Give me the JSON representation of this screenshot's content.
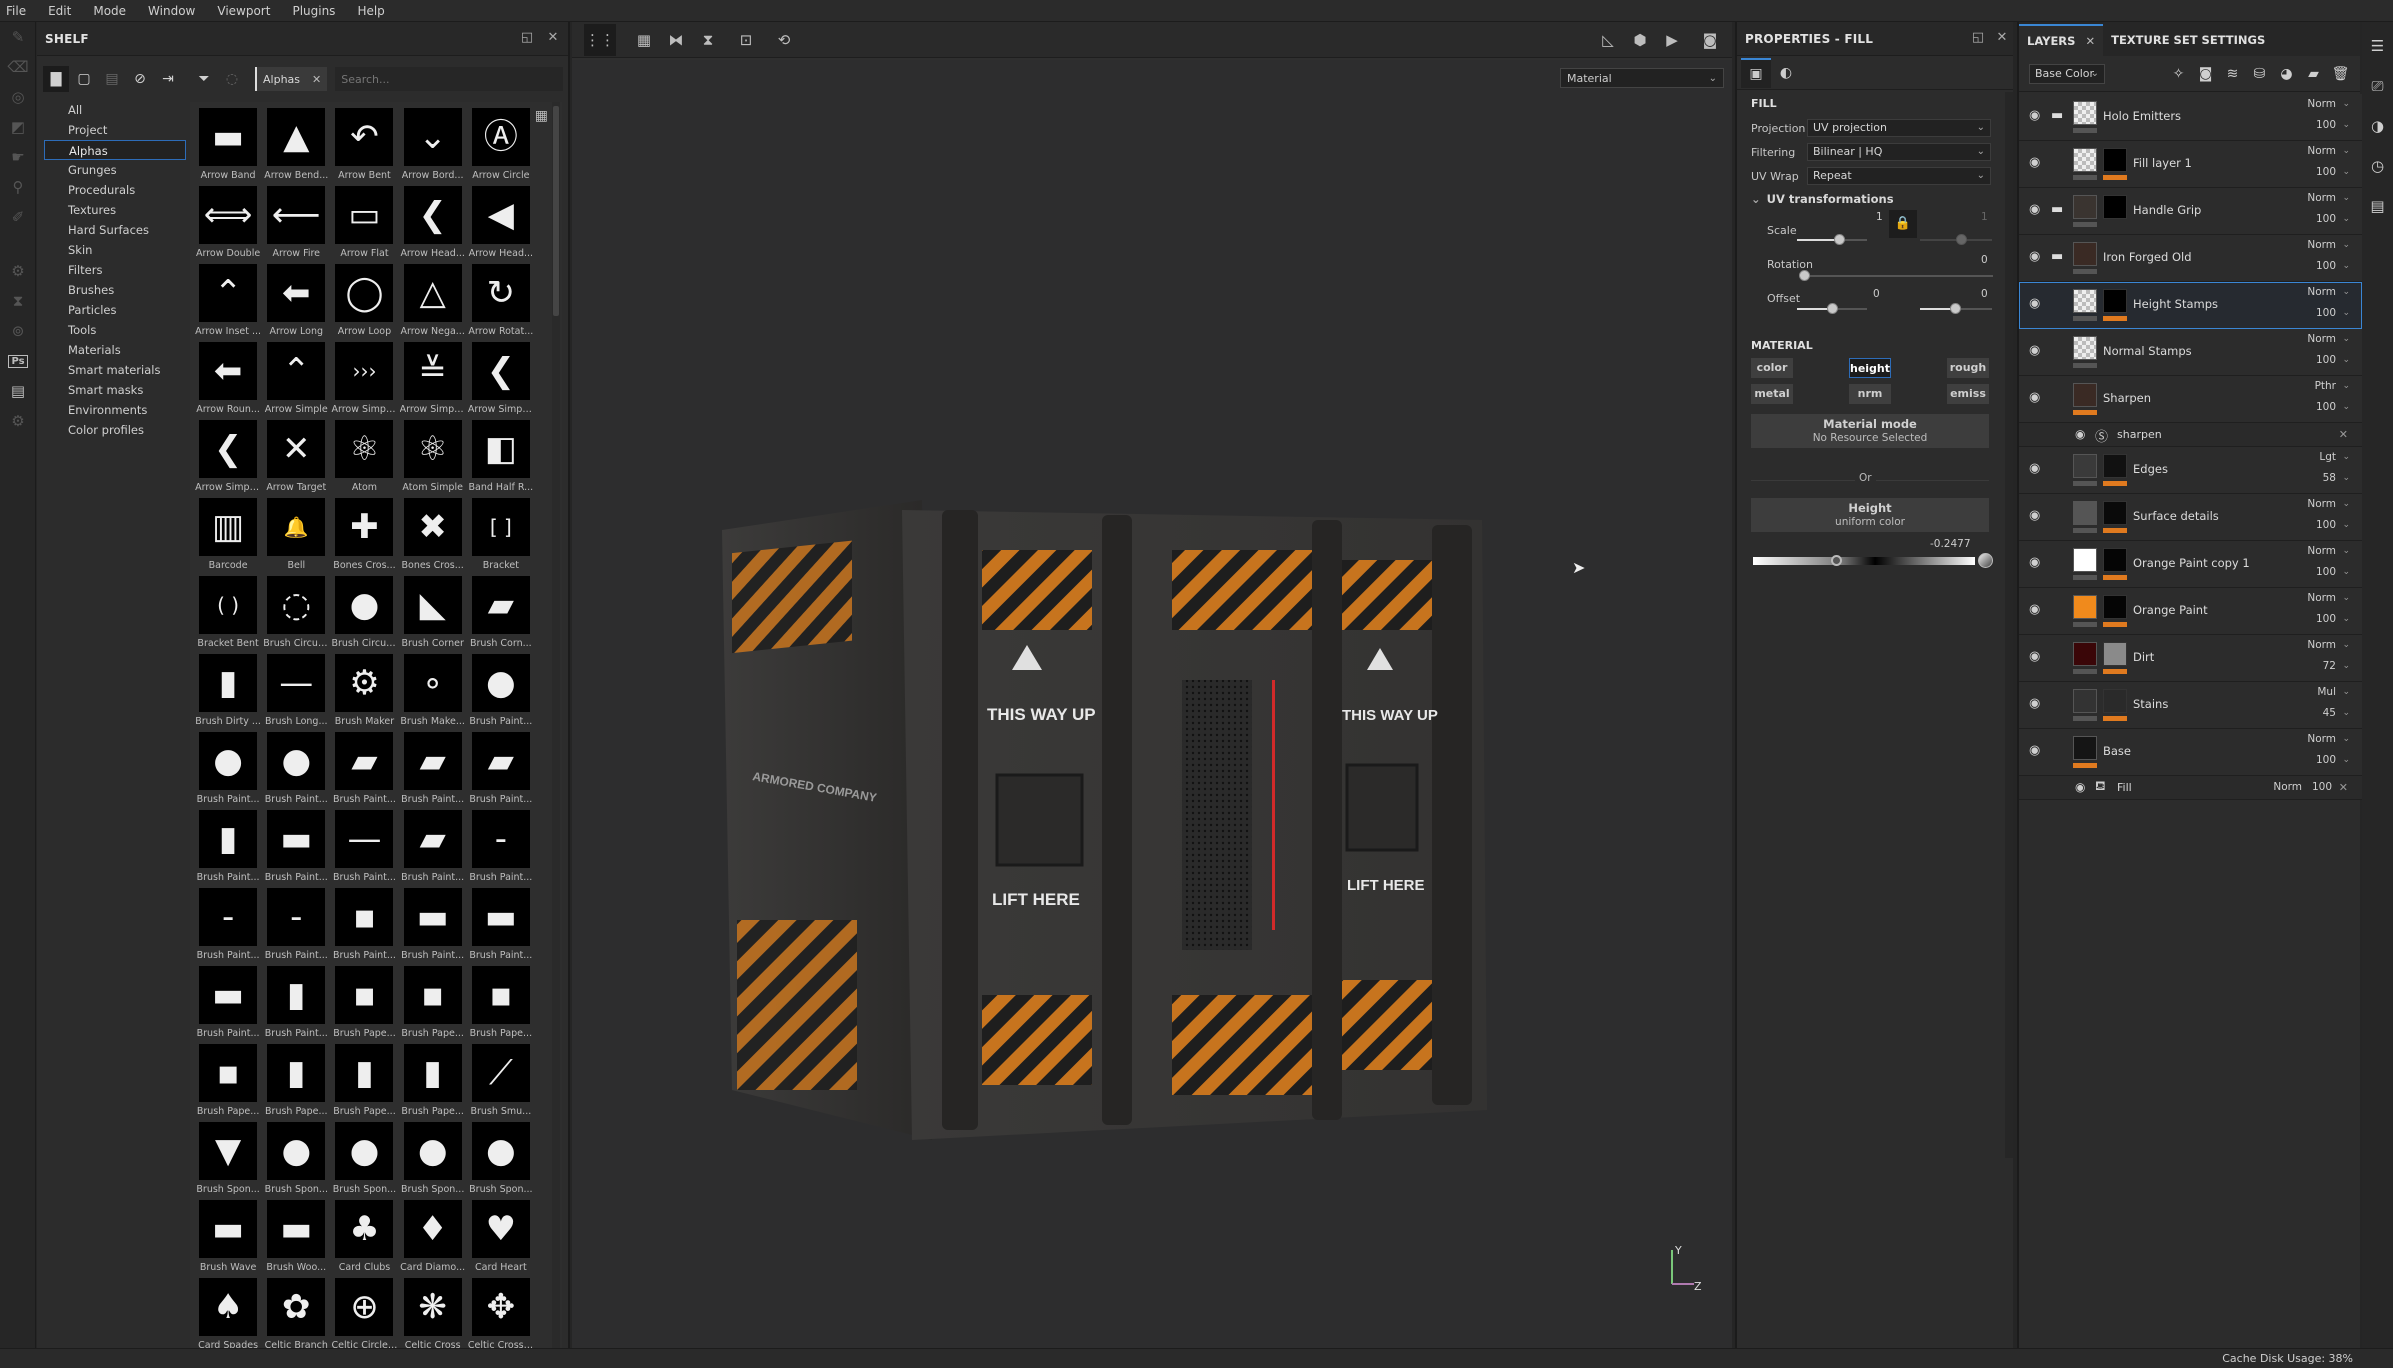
{
  "menu": [
    "File",
    "Edit",
    "Mode",
    "Window",
    "Viewport",
    "Plugins",
    "Help"
  ],
  "toolstrip": [
    "paint-brush-icon",
    "eraser-icon",
    "projection-icon",
    "geometry-mask-icon",
    "smudge-icon",
    "clone-stamp-icon",
    "color-picker-icon",
    "",
    "substance-icon",
    "bake-icon",
    "substance-share-icon",
    "photoshop-export-icon",
    "document-icon",
    "substance-source-icon"
  ],
  "shelf": {
    "title": "SHELF",
    "filter_chip": "Alphas",
    "search_placeholder": "Search...",
    "categories": [
      "All",
      "Project",
      "Alphas",
      "Grunges",
      "Procedurals",
      "Textures",
      "Hard Surfaces",
      "Skin",
      "Filters",
      "Brushes",
      "Particles",
      "Tools",
      "Materials",
      "Smart materials",
      "Smart masks",
      "Environments",
      "Color profiles"
    ],
    "selected_category": "Alphas",
    "items": [
      {
        "name": "Arrow Band",
        "glyph": "▬"
      },
      {
        "name": "Arrow Bend...",
        "glyph": "▲"
      },
      {
        "name": "Arrow Bent",
        "glyph": "↶"
      },
      {
        "name": "Arrow Bord...",
        "glyph": "⌄"
      },
      {
        "name": "Arrow Circle",
        "glyph": "Ⓐ"
      },
      {
        "name": "Arrow Double",
        "glyph": "⟺"
      },
      {
        "name": "Arrow Fire",
        "glyph": "⟵"
      },
      {
        "name": "Arrow Flat",
        "glyph": "▭"
      },
      {
        "name": "Arrow Head...",
        "glyph": "❮"
      },
      {
        "name": "Arrow Head...",
        "glyph": "◀"
      },
      {
        "name": "Arrow Inset ...",
        "glyph": "⌃"
      },
      {
        "name": "Arrow Long",
        "glyph": "⬅"
      },
      {
        "name": "Arrow Loop",
        "glyph": "◯"
      },
      {
        "name": "Arrow Nega...",
        "glyph": "△"
      },
      {
        "name": "Arrow Rotat...",
        "glyph": "↻"
      },
      {
        "name": "Arrow Roun...",
        "glyph": "⬅"
      },
      {
        "name": "Arrow Simple",
        "glyph": "⌃"
      },
      {
        "name": "Arrow Simpl...",
        "glyph": "›››"
      },
      {
        "name": "Arrow Simpl...",
        "glyph": "≚"
      },
      {
        "name": "Arrow Simpl...",
        "glyph": "❮"
      },
      {
        "name": "Arrow Simpl...",
        "glyph": "❮"
      },
      {
        "name": "Arrow Target",
        "glyph": "✕"
      },
      {
        "name": "Atom",
        "glyph": "⚛"
      },
      {
        "name": "Atom Simple",
        "glyph": "⚛"
      },
      {
        "name": "Band Half R...",
        "glyph": "◧"
      },
      {
        "name": "Barcode",
        "glyph": "▥"
      },
      {
        "name": "Bell",
        "glyph": "🔔"
      },
      {
        "name": "Bones Cros...",
        "glyph": "✚"
      },
      {
        "name": "Bones Cros...",
        "glyph": "✖"
      },
      {
        "name": "Bracket",
        "glyph": "[ ]"
      },
      {
        "name": "Bracket Bent",
        "glyph": "( )"
      },
      {
        "name": "Brush Circul...",
        "glyph": "◌"
      },
      {
        "name": "Brush Circul...",
        "glyph": "●"
      },
      {
        "name": "Brush Corner",
        "glyph": "◣"
      },
      {
        "name": "Brush Corn...",
        "glyph": "▰"
      },
      {
        "name": "Brush Dirty ...",
        "glyph": "▮"
      },
      {
        "name": "Brush Long...",
        "glyph": "—"
      },
      {
        "name": "Brush Maker",
        "glyph": "⚙"
      },
      {
        "name": "Brush Make...",
        "glyph": "∘"
      },
      {
        "name": "Brush Paint...",
        "glyph": "●"
      },
      {
        "name": "Brush Paint...",
        "glyph": "●"
      },
      {
        "name": "Brush Paint...",
        "glyph": "●"
      },
      {
        "name": "Brush Paint...",
        "glyph": "▰"
      },
      {
        "name": "Brush Paint...",
        "glyph": "▰"
      },
      {
        "name": "Brush Paint...",
        "glyph": "▰"
      },
      {
        "name": "Brush Paint...",
        "glyph": "▮"
      },
      {
        "name": "Brush Paint...",
        "glyph": "▬"
      },
      {
        "name": "Brush Paint...",
        "glyph": "—"
      },
      {
        "name": "Brush Paint...",
        "glyph": "▰"
      },
      {
        "name": "Brush Paint...",
        "glyph": "-"
      },
      {
        "name": "Brush Paint...",
        "glyph": "-"
      },
      {
        "name": "Brush Paint...",
        "glyph": "-"
      },
      {
        "name": "Brush Paint...",
        "glyph": "▪"
      },
      {
        "name": "Brush Paint...",
        "glyph": "▬"
      },
      {
        "name": "Brush Paint...",
        "glyph": "▬"
      },
      {
        "name": "Brush Paint...",
        "glyph": "▬"
      },
      {
        "name": "Brush Paint...",
        "glyph": "▮"
      },
      {
        "name": "Brush Pape...",
        "glyph": "▪"
      },
      {
        "name": "Brush Pape...",
        "glyph": "▪"
      },
      {
        "name": "Brush Pape...",
        "glyph": "▪"
      },
      {
        "name": "Brush Pape...",
        "glyph": "▪"
      },
      {
        "name": "Brush Pape...",
        "glyph": "▮"
      },
      {
        "name": "Brush Pape...",
        "glyph": "▮"
      },
      {
        "name": "Brush Pape...",
        "glyph": "▮"
      },
      {
        "name": "Brush Smu...",
        "glyph": "⟋"
      },
      {
        "name": "Brush Spon...",
        "glyph": "▼"
      },
      {
        "name": "Brush Spon...",
        "glyph": "●"
      },
      {
        "name": "Brush Spon...",
        "glyph": "●"
      },
      {
        "name": "Brush Spon...",
        "glyph": "●"
      },
      {
        "name": "Brush Spon...",
        "glyph": "●"
      },
      {
        "name": "Brush Wave",
        "glyph": "▬"
      },
      {
        "name": "Brush Woo...",
        "glyph": "▬"
      },
      {
        "name": "Card Clubs",
        "glyph": "♣"
      },
      {
        "name": "Card Diamo...",
        "glyph": "♦"
      },
      {
        "name": "Card Heart",
        "glyph": "♥"
      },
      {
        "name": "Card Spades",
        "glyph": "♠"
      },
      {
        "name": "Celtic Branch",
        "glyph": "✿"
      },
      {
        "name": "Celtic Circle ...",
        "glyph": "⊕"
      },
      {
        "name": "Celtic Cross",
        "glyph": "❋"
      },
      {
        "name": "Celtic Cross ...",
        "glyph": "✥"
      }
    ]
  },
  "viewport": {
    "channel_select": "Material",
    "model_labels": [
      "THIS WAY UP",
      "LIFT HERE",
      "ARMORED COMPANY"
    ],
    "axis_labels": {
      "y": "Y",
      "z": "Z"
    }
  },
  "properties": {
    "title": "PROPERTIES - FILL",
    "fill_section": "FILL",
    "projection_label": "Projection",
    "projection_value": "UV projection",
    "filtering_label": "Filtering",
    "filtering_value": "Bilinear | HQ",
    "uvwrap_label": "UV Wrap",
    "uvwrap_value": "Repeat",
    "uv_transformations": "UV transformations",
    "scale_label": "Scale",
    "scale_u": "1",
    "scale_v": "1",
    "rotation_label": "Rotation",
    "rotation_value": "0",
    "offset_label": "Offset",
    "offset_u": "0",
    "offset_v": "0",
    "material_section": "MATERIAL",
    "channels": [
      {
        "label": "color",
        "active": false
      },
      {
        "label": "height",
        "active": true
      },
      {
        "label": "rough",
        "active": false
      },
      {
        "label": "metal",
        "active": false
      },
      {
        "label": "nrm",
        "active": false
      },
      {
        "label": "emiss",
        "active": false
      }
    ],
    "material_mode_title": "Material mode",
    "material_mode_sub": "No Resource Selected",
    "or_label": "Or",
    "height_title": "Height",
    "height_sub": "uniform color",
    "height_value": "-0.2477",
    "height_normalized": 0.38
  },
  "layers": {
    "tab_layers": "LAYERS",
    "tab_texture_set": "TEXTURE SET SETTINGS",
    "channel_select": "Base Color",
    "rows": [
      {
        "name": "Holo Emitters",
        "blend": "Norm",
        "opacity": "100",
        "folder": true,
        "thumb": "checker",
        "mask": null,
        "bar": "#555555",
        "selected": false
      },
      {
        "name": "Fill layer 1",
        "blend": "Norm",
        "opacity": "100",
        "folder": false,
        "thumb": "checker",
        "mask": "#000000",
        "bar": "#e07a1f",
        "selected": false
      },
      {
        "name": "Handle Grip",
        "blend": "Norm",
        "opacity": "100",
        "folder": true,
        "thumb": "#3a3430",
        "mask": "#000000",
        "bar": null,
        "selected": false
      },
      {
        "name": "Iron Forged Old",
        "blend": "Norm",
        "opacity": "100",
        "folder": true,
        "thumb": "#3a2a24",
        "mask": null,
        "bar": "#555555",
        "selected": false
      },
      {
        "name": "Height Stamps",
        "blend": "Norm",
        "opacity": "100",
        "folder": false,
        "thumb": "checker",
        "mask": "#000000",
        "bar": "#e07a1f",
        "selected": true
      },
      {
        "name": "Normal Stamps",
        "blend": "Norm",
        "opacity": "100",
        "folder": false,
        "thumb": "checker",
        "mask": null,
        "bar": "#555555",
        "selected": false
      },
      {
        "name": "Sharpen",
        "blend": "Pthr",
        "opacity": "100",
        "folder": false,
        "thumb": "#3a2a24",
        "mask": null,
        "bar": "#e07a1f",
        "selected": false,
        "sub": {
          "name": "sharpen",
          "icon": "substance-icon"
        }
      },
      {
        "name": "Edges",
        "blend": "Lgt",
        "opacity": "58",
        "folder": false,
        "thumb": "#3a3a3a",
        "mask": "#111111",
        "bar": "#e07a1f",
        "selected": false
      },
      {
        "name": "Surface details",
        "blend": "Norm",
        "opacity": "100",
        "folder": false,
        "thumb": "#555555",
        "mask": "#0a0a0a",
        "bar": "#e07a1f",
        "selected": false
      },
      {
        "name": "Orange Paint copy 1",
        "blend": "Norm",
        "opacity": "100",
        "folder": false,
        "thumb": "#ffffff",
        "mask": "#050505",
        "bar": "#e07a1f",
        "selected": false
      },
      {
        "name": "Orange Paint",
        "blend": "Norm",
        "opacity": "100",
        "folder": false,
        "thumb": "#f08a1c",
        "mask": "#050505",
        "bar": "#e07a1f",
        "selected": false
      },
      {
        "name": "Dirt",
        "blend": "Norm",
        "opacity": "72",
        "folder": false,
        "thumb": "#3a0608",
        "mask": "#8a8a8a",
        "bar": "#e07a1f",
        "selected": false
      },
      {
        "name": "Stains",
        "blend": "Mul",
        "opacity": "45",
        "folder": false,
        "thumb": "#333333",
        "mask": "#2a2a2a",
        "bar": "#e07a1f",
        "selected": false
      },
      {
        "name": "Base",
        "blend": "Norm",
        "opacity": "100",
        "folder": false,
        "thumb": "#151515",
        "mask": null,
        "bar": "#e07a1f",
        "selected": false,
        "sub": {
          "name": "Fill",
          "icon": "fill-bucket-icon",
          "blend": "Norm",
          "opacity": "100"
        }
      }
    ]
  },
  "status": {
    "cache": "Cache Disk Usage:   38%"
  }
}
